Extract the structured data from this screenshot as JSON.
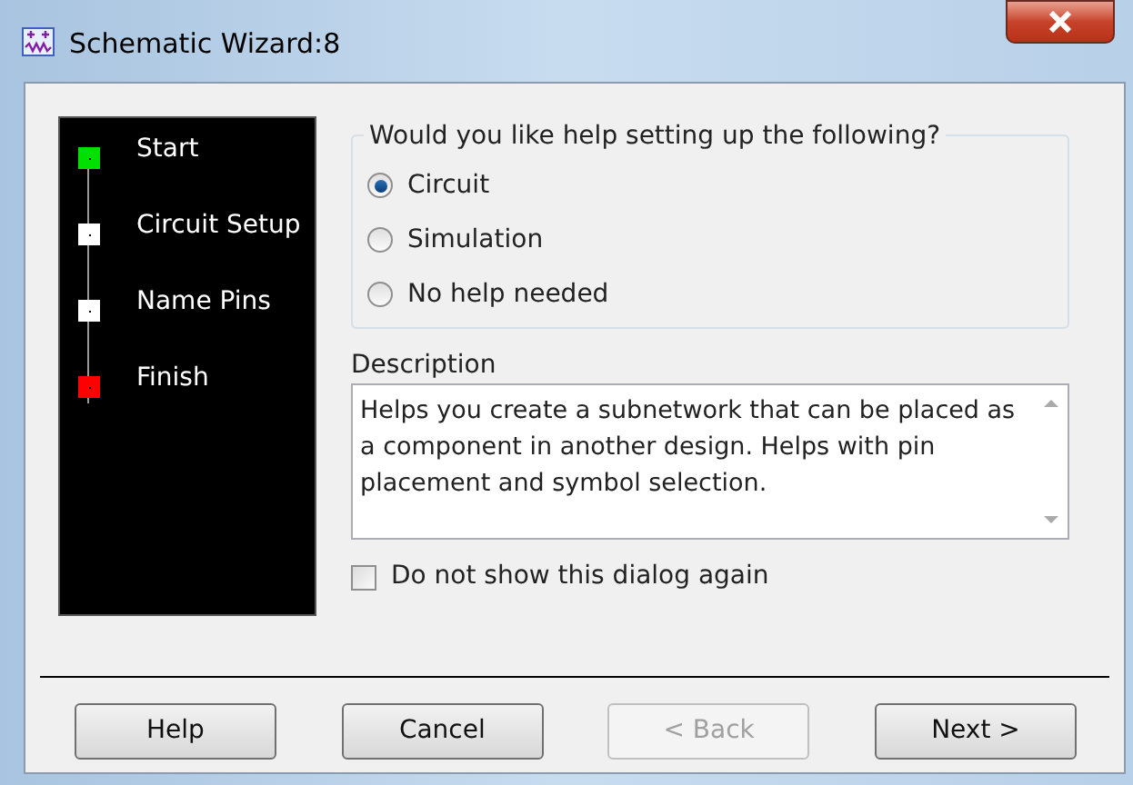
{
  "window": {
    "title": "Schematic Wizard:8"
  },
  "steps": [
    {
      "label": "Start",
      "color": "#00e000"
    },
    {
      "label": "Circuit Setup",
      "color": "#ffffff"
    },
    {
      "label": "Name Pins",
      "color": "#ffffff"
    },
    {
      "label": "Finish",
      "color": "#ff0000"
    }
  ],
  "question": {
    "legend": "Would you like help setting up the following?",
    "options": [
      {
        "label": "Circuit",
        "selected": true
      },
      {
        "label": "Simulation",
        "selected": false
      },
      {
        "label": "No help needed",
        "selected": false
      }
    ]
  },
  "description": {
    "label": "Description",
    "text": "Helps you create a subnetwork that can be placed as a component in another design. Helps with pin placement and symbol selection."
  },
  "dont_show": {
    "label": "Do not show this dialog again",
    "checked": false
  },
  "buttons": [
    {
      "label": "Help",
      "disabled": false
    },
    {
      "label": "Cancel",
      "disabled": false
    },
    {
      "label": "< Back",
      "disabled": true
    },
    {
      "label": "Next >",
      "disabled": false
    }
  ]
}
